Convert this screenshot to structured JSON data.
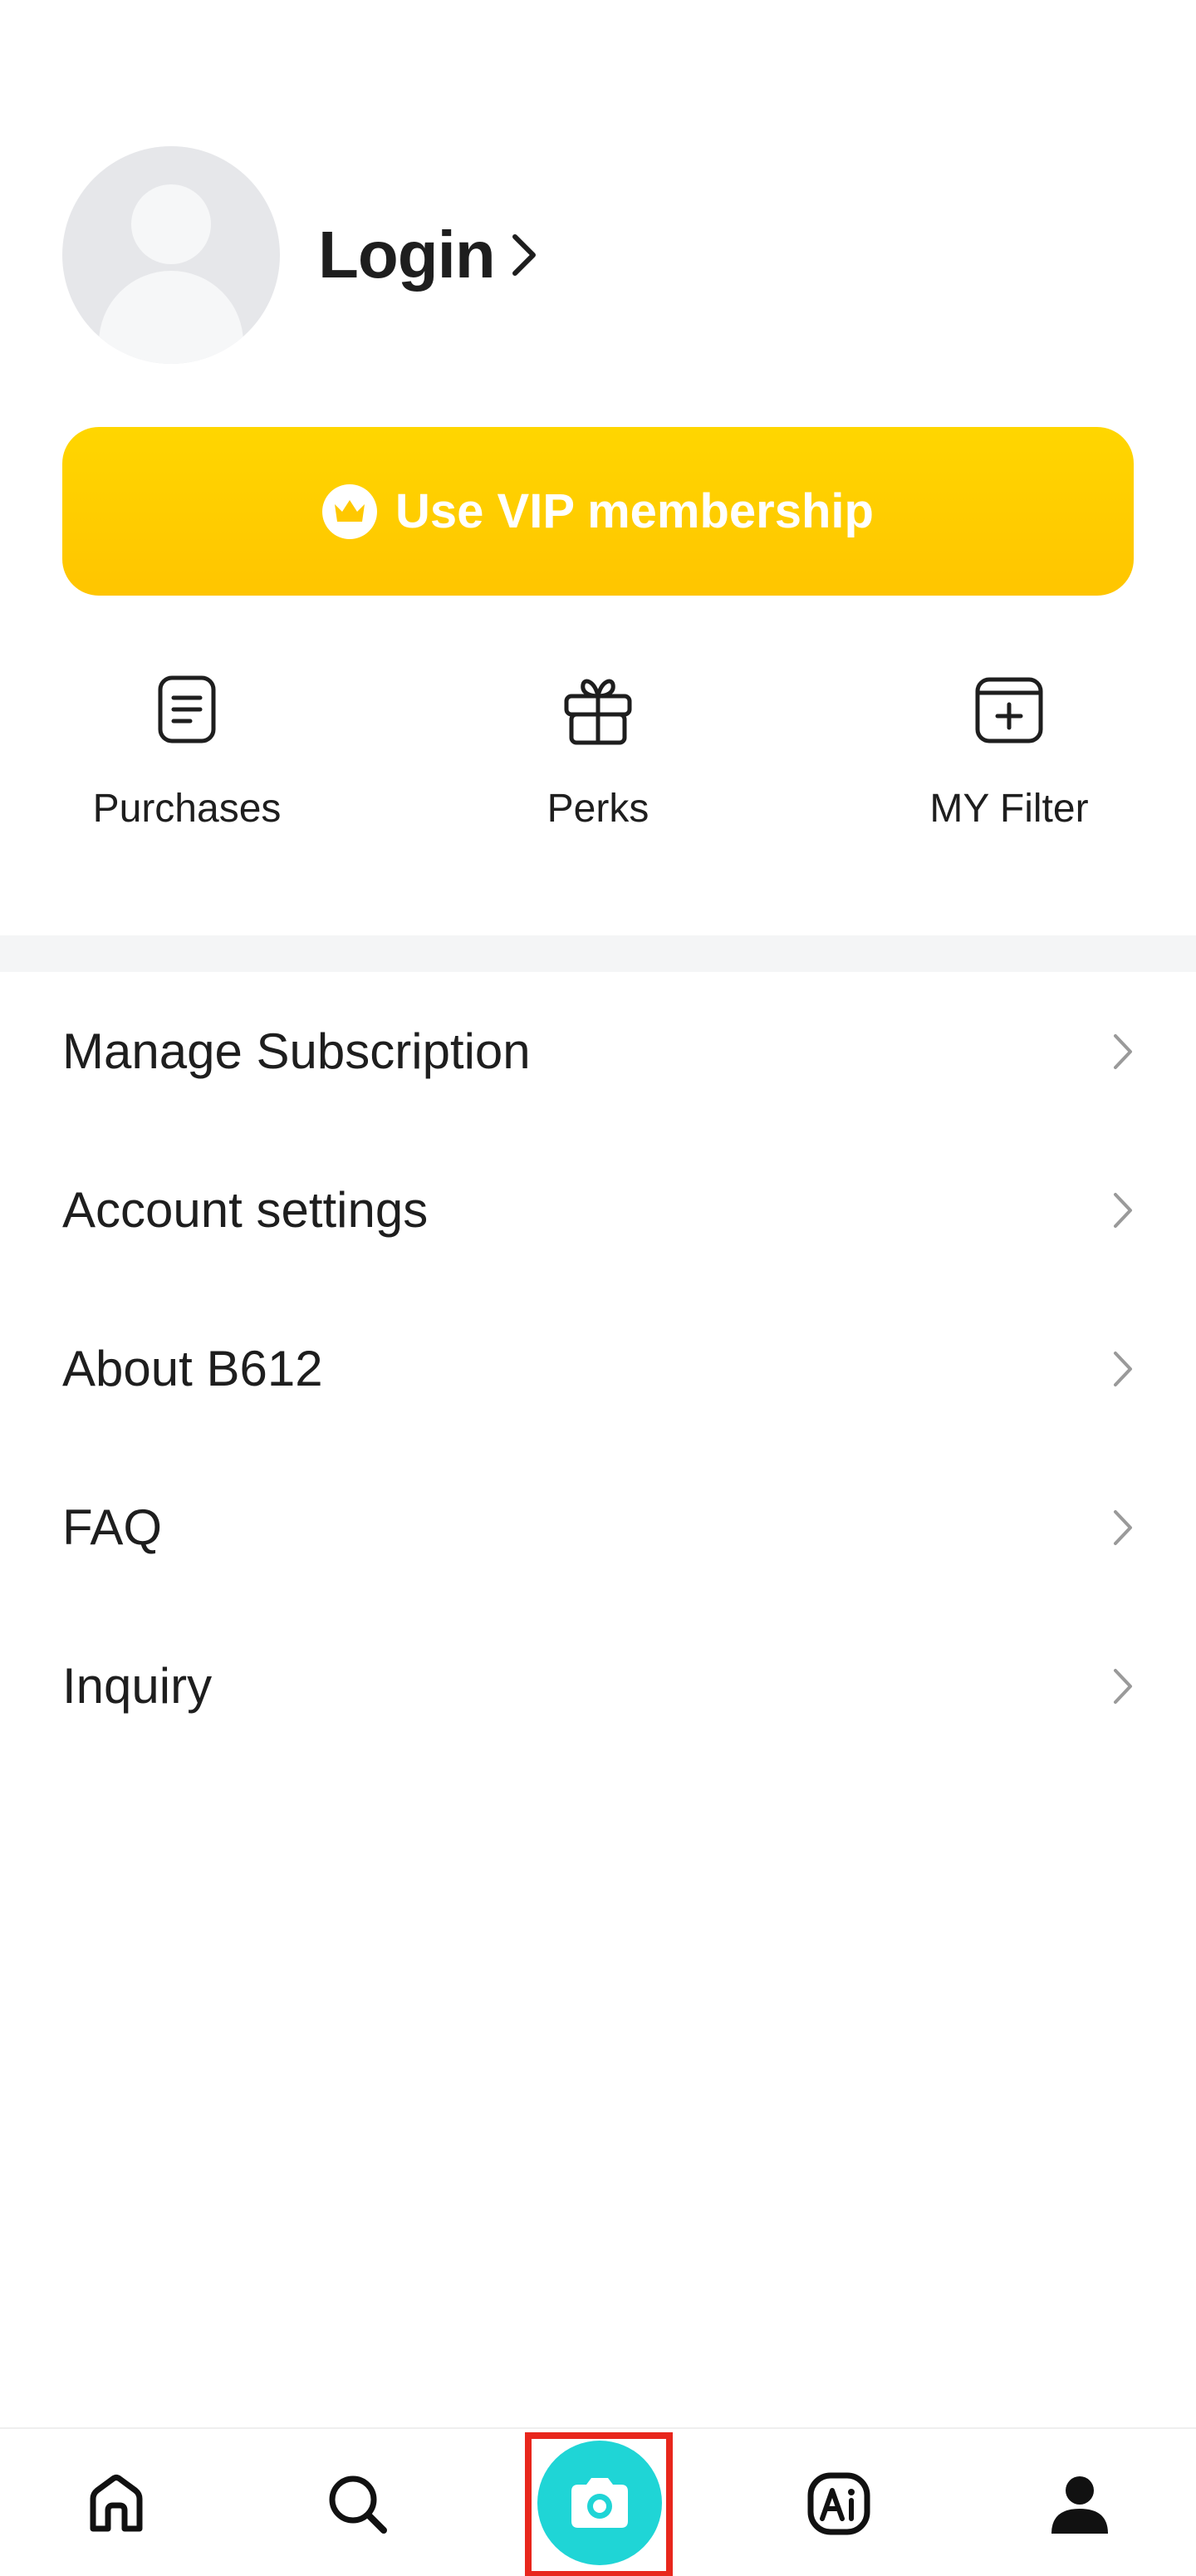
{
  "profile": {
    "login_label": "Login",
    "avatar_icon": "user-avatar-icon"
  },
  "vip": {
    "label": "Use VIP membership",
    "icon": "crown-icon",
    "color": "#FFD000"
  },
  "quick_actions": [
    {
      "label": "Purchases",
      "icon": "receipt-icon"
    },
    {
      "label": "Perks",
      "icon": "gift-icon"
    },
    {
      "label": "MY Filter",
      "icon": "add-filter-icon"
    }
  ],
  "menu": [
    {
      "label": "Manage Subscription"
    },
    {
      "label": "Account settings"
    },
    {
      "label": "About B612"
    },
    {
      "label": "FAQ"
    },
    {
      "label": "Inquiry"
    }
  ],
  "bottom_nav": {
    "items": [
      "home-icon",
      "search-icon",
      "camera-icon",
      "ai-icon",
      "profile-icon"
    ],
    "camera_color": "#1FD5D6",
    "highlight_color": "#E8261C"
  }
}
